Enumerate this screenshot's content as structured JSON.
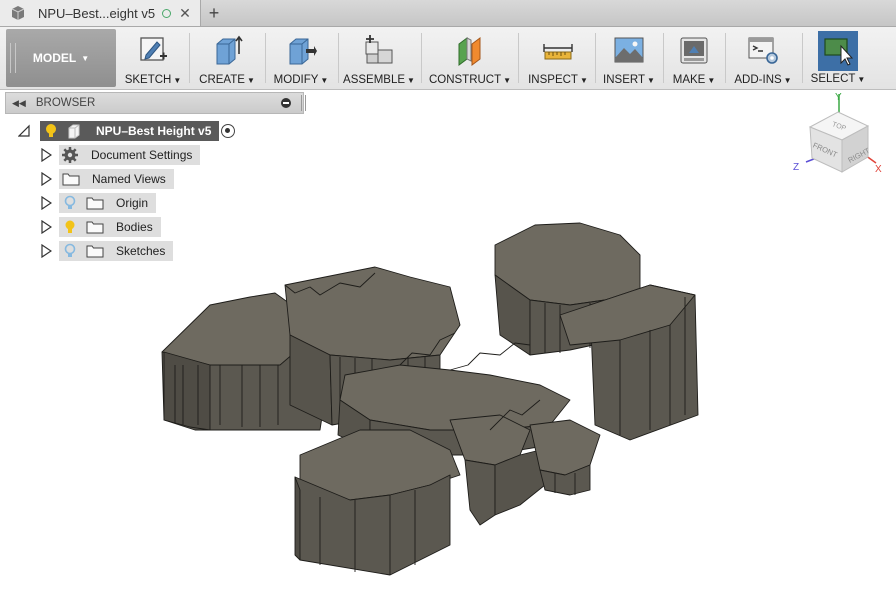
{
  "tab": {
    "title": "NPU–Best...eight v5",
    "close_glyph": "✕",
    "new_glyph": "+"
  },
  "toolbar": {
    "workspace": "MODEL",
    "items": [
      {
        "label": "SKETCH",
        "icon": "sketch-icon"
      },
      {
        "label": "CREATE",
        "icon": "create-icon"
      },
      {
        "label": "MODIFY",
        "icon": "modify-icon"
      },
      {
        "label": "ASSEMBLE",
        "icon": "assemble-icon"
      },
      {
        "label": "CONSTRUCT",
        "icon": "construct-icon"
      },
      {
        "label": "INSPECT",
        "icon": "inspect-icon"
      },
      {
        "label": "INSERT",
        "icon": "insert-icon"
      },
      {
        "label": "MAKE",
        "icon": "make-icon"
      },
      {
        "label": "ADD-INS",
        "icon": "add-ins-icon"
      },
      {
        "label": "SELECT",
        "icon": "select-icon"
      }
    ]
  },
  "browser": {
    "title": "BROWSER",
    "root": "NPU–Best Height v5",
    "items": [
      {
        "label": "Document Settings",
        "icon": "gear-icon"
      },
      {
        "label": "Named Views",
        "icon": "folder-icon"
      },
      {
        "label": "Origin",
        "icon": "folder-icon"
      },
      {
        "label": "Bodies",
        "icon": "folder-icon"
      },
      {
        "label": "Sketches",
        "icon": "folder-icon"
      }
    ]
  },
  "viewcube": {
    "top": "TOP",
    "front": "FRONT",
    "right": "RIGHT",
    "x": "X",
    "y": "Y",
    "z": "Z"
  },
  "colors": {
    "accent": "#4f7fb3",
    "select_bg": "#3d6fa6",
    "model_face": "#6e6a60",
    "model_side": "#5b5850",
    "bulb_on": "#f2c318",
    "bulb_off": "#86b9e0"
  }
}
